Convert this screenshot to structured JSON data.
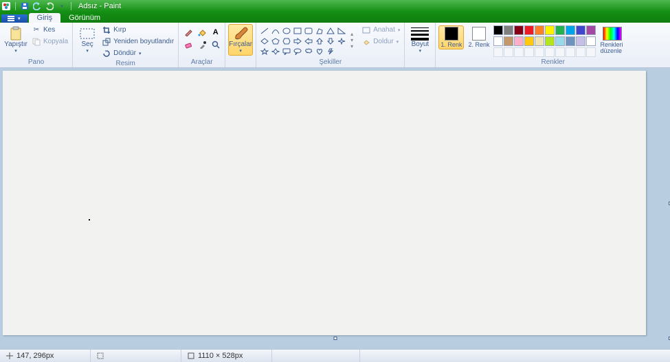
{
  "titlebar": {
    "title": "Adsız - Paint"
  },
  "tabs": {
    "file_glyph": "▾",
    "home": "Giriş",
    "view": "Görünüm"
  },
  "ribbon": {
    "pano": {
      "group": "Pano",
      "paste": "Yapıştır",
      "cut": "Kes",
      "copy": "Kopyala"
    },
    "resim": {
      "group": "Resim",
      "select": "Seç",
      "crop": "Kırp",
      "resize": "Yeniden boyutlandır",
      "rotate": "Döndür"
    },
    "araclar": {
      "group": "Araçlar"
    },
    "fircalar": {
      "group": "",
      "brushes": "Fırçalar"
    },
    "sekiller": {
      "group": "Şekiller",
      "outline": "Anahat",
      "fill": "Doldur"
    },
    "boyut": {
      "group": "",
      "size": "Boyut"
    },
    "renkler": {
      "group": "Renkler",
      "color1": "1. Renk",
      "color2": "2. Renk",
      "edit": "Renkleri düzenle",
      "palette": [
        [
          "#000000",
          "#7f7f7f",
          "#880015",
          "#ed1c24",
          "#ff7f27",
          "#fff200",
          "#22b14c",
          "#00a2e8",
          "#3f48cc",
          "#a349a4"
        ],
        [
          "#ffffff",
          "#c3996b",
          "#ffaec9",
          "#ffc90e",
          "#efe4b0",
          "#b5e61d",
          "#99d9ea",
          "#7092be",
          "#c8bfe7",
          "#ffffff"
        ]
      ],
      "custom_row": [
        "",
        "",
        "",
        "",
        "",
        "",
        "",
        "",
        "",
        ""
      ]
    }
  },
  "status": {
    "pos": "147, 296px",
    "size": "1110 × 528px"
  }
}
